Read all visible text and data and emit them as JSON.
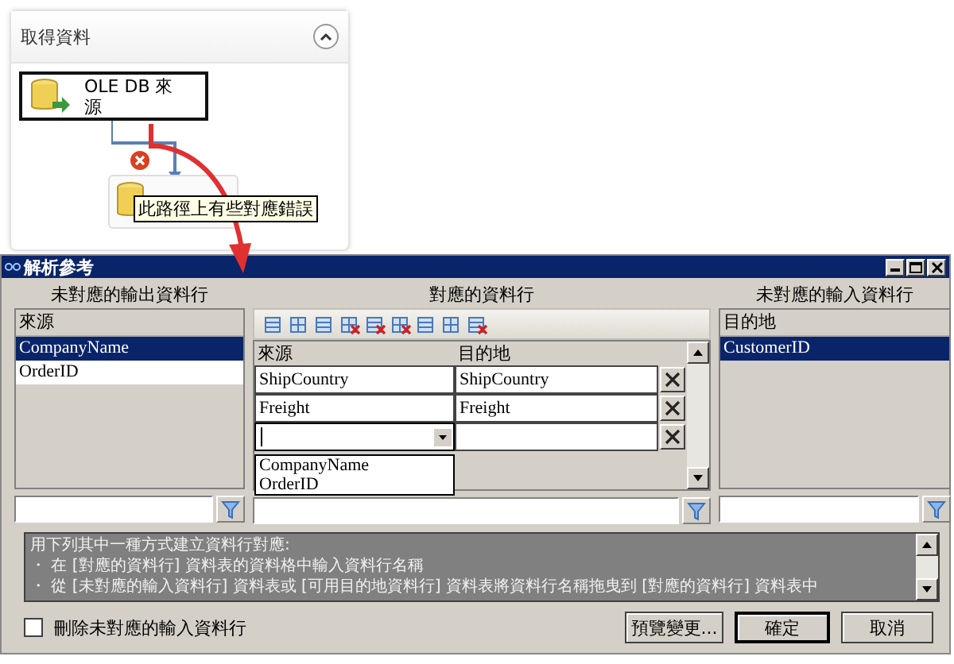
{
  "designer": {
    "panel_title": "取得資料",
    "source_node": {
      "label": "OLE DB 來源"
    },
    "tooltip": "此路徑上有些對應錯誤"
  },
  "dialog": {
    "title": "解析參考",
    "unmapped_output": {
      "heading": "未對應的輸出資料行",
      "column_header": "來源",
      "rows": [
        {
          "name": "CompanyName",
          "selected": true
        },
        {
          "name": "OrderID",
          "selected": false
        }
      ]
    },
    "mapped": {
      "heading": "對應的資料行",
      "columns": [
        "來源",
        "目的地"
      ],
      "rows": [
        {
          "kind": "text",
          "source": "ShipCountry",
          "destination": "ShipCountry"
        },
        {
          "kind": "text",
          "source": "Freight",
          "destination": "Freight"
        },
        {
          "kind": "combo"
        }
      ],
      "dropdown_options": [
        "CompanyName",
        "OrderID"
      ]
    },
    "unmapped_input": {
      "heading": "未對應的輸入資料行",
      "column_header": "目的地",
      "rows": [
        {
          "name": "CustomerID",
          "selected": true
        }
      ]
    },
    "info_lines": [
      "用下列其中一種方式建立資料行對應:",
      "・ 在 [對應的資料行] 資料表的資料格中輸入資料行名稱",
      "・ 從 [未對應的輸入資料行] 資料表或 [可用目的地資料行] 資料表將資料行名稱拖曳到 [對應的資料行] 資料表中"
    ],
    "checkbox": {
      "label": "刪除未對應的輸入資料行",
      "checked": false
    },
    "buttons": [
      {
        "label": "預覽變更...",
        "default": false
      },
      {
        "label": "確定",
        "default": true
      },
      {
        "label": "取消",
        "default": false
      }
    ]
  }
}
